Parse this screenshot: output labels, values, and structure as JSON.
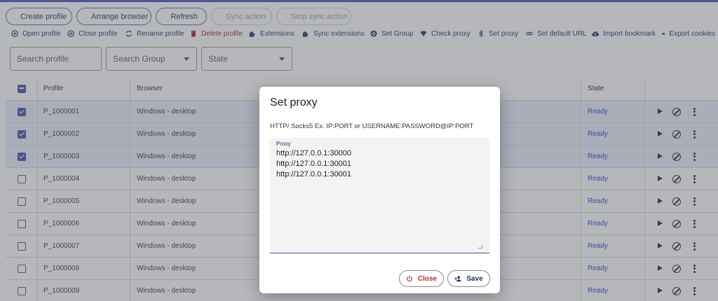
{
  "toolbar": {
    "buttons": [
      {
        "label": "Create profile",
        "icon": "account-box-icon",
        "disabled": false
      },
      {
        "label": "Arrange browser",
        "icon": "window-icon",
        "disabled": false
      },
      {
        "label": "Refresh",
        "icon": "refresh-icon",
        "disabled": false
      },
      {
        "label": "Sync action",
        "icon": "mouse-icon",
        "disabled": true
      },
      {
        "label": "Stop sync action",
        "icon": "stop-icon",
        "disabled": true
      }
    ],
    "actions": [
      {
        "label": "Open profile",
        "icon": "plus-circle-icon"
      },
      {
        "label": "Close profile",
        "icon": "close-circle-icon"
      },
      {
        "label": "Rename profile",
        "icon": "sync-icon"
      },
      {
        "label": "Delete profile",
        "icon": "trash-icon"
      },
      {
        "label": "Extensions",
        "icon": "puzzle-icon"
      },
      {
        "label": "Sync extensions",
        "icon": "puzzle-icon"
      },
      {
        "label": "Set Group",
        "icon": "group-icon"
      },
      {
        "label": "Check proxy",
        "icon": "wifi-icon"
      },
      {
        "label": "Set proxy",
        "icon": "bluetooth-icon"
      },
      {
        "label": "Set default URL",
        "icon": "link-icon"
      },
      {
        "label": "Import bookmark",
        "icon": "cloud-upload-icon"
      },
      {
        "label": "Export cookies",
        "icon": "cloud-download-icon"
      }
    ]
  },
  "filters": {
    "search_profile": "Search profile",
    "search_group": "Search Group",
    "state": "State"
  },
  "table": {
    "columns": [
      "Profile",
      "Browser",
      "State"
    ],
    "rows": [
      {
        "profile": "P_1000001",
        "browser": "Windows - desktop",
        "state": "Ready",
        "checked": true
      },
      {
        "profile": "P_1000002",
        "browser": "Windows - desktop",
        "state": "Ready",
        "checked": true
      },
      {
        "profile": "P_1000003",
        "browser": "Windows - desktop",
        "state": "Ready",
        "checked": true
      },
      {
        "profile": "P_1000004",
        "browser": "Windows - desktop",
        "state": "Ready",
        "checked": false
      },
      {
        "profile": "P_1000005",
        "browser": "Windows - desktop",
        "state": "Ready",
        "checked": false
      },
      {
        "profile": "P_1000006",
        "browser": "Windows - desktop",
        "state": "Ready",
        "checked": false
      },
      {
        "profile": "P_1000007",
        "browser": "Windows - desktop",
        "state": "Ready",
        "checked": false
      },
      {
        "profile": "P_1000008",
        "browser": "Windows - desktop",
        "state": "Ready",
        "checked": false
      },
      {
        "profile": "P_1000009",
        "browser": "Windows - desktop",
        "state": "Ready",
        "checked": false
      }
    ]
  },
  "dialog": {
    "title": "Set proxy",
    "hint": "HTTP/ Socks5 Ex. IP:PORT or USERNAME:PASSWORD@IP:PORT",
    "proxy_label": "Proxy",
    "proxy_value": "http://127.0.0.1:30000\nhttp://127.0.0.1:30001\nhttp://127.0.0.1:30001",
    "close_label": "Close",
    "save_label": "Save"
  },
  "colors": {
    "accent": "#3f51b5",
    "toolbar_text": "#1b2f6b",
    "danger": "#a32020",
    "ready": "#2a3cc9"
  }
}
